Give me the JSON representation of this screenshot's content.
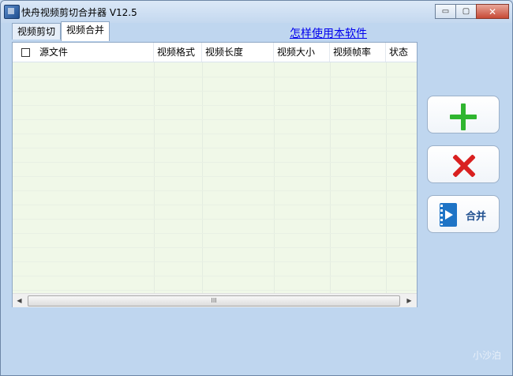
{
  "window": {
    "title": "快舟视频剪切合并器 V12.5",
    "controls": {
      "minimize": "▭",
      "maximize": "▢",
      "close": "✕"
    }
  },
  "tabs": [
    {
      "label": "视频剪切",
      "active": false
    },
    {
      "label": "视频合并",
      "active": true
    }
  ],
  "help_link": "怎样使用本软件",
  "table": {
    "columns": [
      "源文件",
      "视频格式",
      "视频长度",
      "视频大小",
      "视频帧率",
      "状态"
    ],
    "rows": []
  },
  "scrollbar": {
    "left_arrow": "◀",
    "right_arrow": "▶",
    "thumb_grip": "III"
  },
  "buttons": {
    "add_icon": "plus-icon",
    "remove_icon": "x-icon",
    "merge_label": "合并",
    "merge_icon": "film-icon"
  },
  "watermark": "小沙泊",
  "colors": {
    "grid_bg": "#f0f8e8",
    "window_bg": "#bfd6ef",
    "link": "#0000ee",
    "add": "#2fb52f",
    "remove": "#d92020",
    "merge": "#1e74c6"
  }
}
